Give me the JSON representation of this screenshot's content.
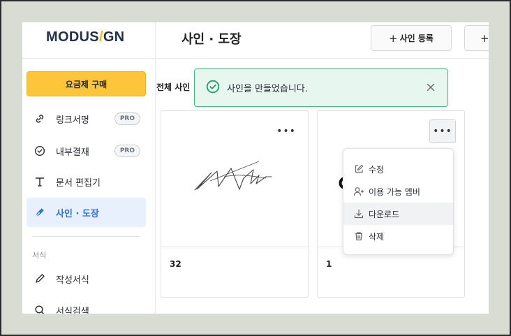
{
  "logo": {
    "left": "MODUS",
    "slash": "/",
    "right": "GN"
  },
  "sidebar": {
    "upgrade_label": "요금제 구매",
    "items": [
      {
        "label": "링크서명",
        "badge": "PRO",
        "icon": "link-icon"
      },
      {
        "label": "내부결재",
        "badge": "PRO",
        "icon": "check-circle-icon"
      },
      {
        "label": "문서 편집기",
        "icon": "text-icon"
      },
      {
        "label": "사인 · 도장",
        "icon": "pen-nib-icon",
        "active": true
      }
    ],
    "section_label": "서식",
    "form_items": [
      {
        "label": "작성서식",
        "icon": "pencil-icon"
      },
      {
        "label": "서식검색",
        "icon": "search-icon"
      }
    ]
  },
  "header": {
    "title": "사인 · 도장",
    "add_signature_label": "사인 등록",
    "second_button_label": "+"
  },
  "main": {
    "filter_label": "전체 사인"
  },
  "toast": {
    "message": "사인을 만들었습니다."
  },
  "cards": [
    {
      "name": "32"
    },
    {
      "name": "1"
    }
  ],
  "card_menu": {
    "items": [
      {
        "label": "수정",
        "icon": "edit-icon"
      },
      {
        "label": "이용 가능 멤버",
        "icon": "user-add-icon"
      },
      {
        "label": "다운로드",
        "icon": "download-icon"
      },
      {
        "label": "삭제",
        "icon": "trash-icon"
      }
    ]
  },
  "colors": {
    "accent": "#2f6fe0",
    "upgrade": "#fcc53a",
    "toast_border": "#49b98c",
    "toast_bg": "#e8f6f0"
  }
}
